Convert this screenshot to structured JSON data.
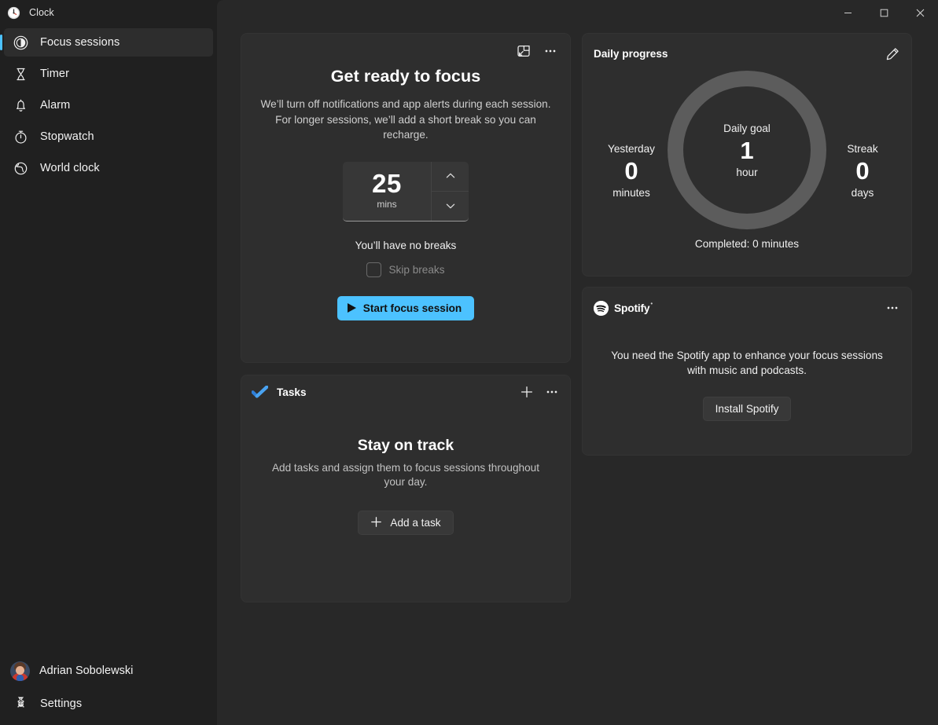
{
  "window": {
    "app_title": "Clock",
    "app_icon": "clock-icon",
    "minimize": "—",
    "maximize": "□",
    "close": "✕"
  },
  "sidebar": {
    "items": [
      {
        "label": "Focus sessions",
        "icon": "focus-sessions-icon",
        "selected": true
      },
      {
        "label": "Timer",
        "icon": "timer-hourglass-icon",
        "selected": false
      },
      {
        "label": "Alarm",
        "icon": "alarm-bell-icon",
        "selected": false
      },
      {
        "label": "Stopwatch",
        "icon": "stopwatch-icon",
        "selected": false
      },
      {
        "label": "World clock",
        "icon": "globe-icon",
        "selected": false
      }
    ],
    "account_name": "Adrian Sobolewski",
    "account_icon": "avatar",
    "settings_label": "Settings",
    "settings_icon": "gear-icon",
    "accent_color": "#4cc2ff"
  },
  "focus_card": {
    "mini_view_icon": "mini-view-icon",
    "more_icon": "more-options-icon",
    "title": "Get ready to focus",
    "description": "We’ll turn off notifications and app alerts during each session. For longer sessions, we’ll add a short break so you can recharge.",
    "duration_value": "25",
    "duration_unit": "mins",
    "increase_icon": "chevron-up-icon",
    "decrease_icon": "chevron-down-icon",
    "breaks_text": "You’ll have no breaks",
    "skip_breaks_label": "Skip breaks",
    "skip_breaks_checked": false,
    "start_button_label": "Start focus session",
    "start_button_icon": "play-icon",
    "start_button_color": "#4cc2ff"
  },
  "tasks_card": {
    "header_label": "Tasks",
    "header_icon": "todo-check-icon",
    "add_icon": "plus-icon",
    "more_icon": "more-options-icon",
    "empty_title": "Stay on track",
    "empty_subtitle": "Add tasks and assign them to focus sessions throughout your day.",
    "add_task_label": "Add a task",
    "add_task_icon": "plus-icon"
  },
  "progress_card": {
    "title": "Daily progress",
    "edit_icon": "pencil-edit-icon",
    "ring_color": "#5c5c5c",
    "ring_progress_percent": 0,
    "center": {
      "label": "Daily goal",
      "value": "1",
      "unit": "hour"
    },
    "yesterday": {
      "label": "Yesterday",
      "value": "0",
      "unit": "minutes"
    },
    "streak": {
      "label": "Streak",
      "value": "0",
      "unit": "days"
    },
    "completed_text": "Completed: 0 minutes"
  },
  "spotify_card": {
    "brand": "Spotify",
    "brand_icon": "spotify-icon",
    "trademark": "•",
    "more_icon": "more-options-icon",
    "message": "You need the Spotify app to enhance your focus sessions with music and podcasts.",
    "install_label": "Install Spotify"
  }
}
